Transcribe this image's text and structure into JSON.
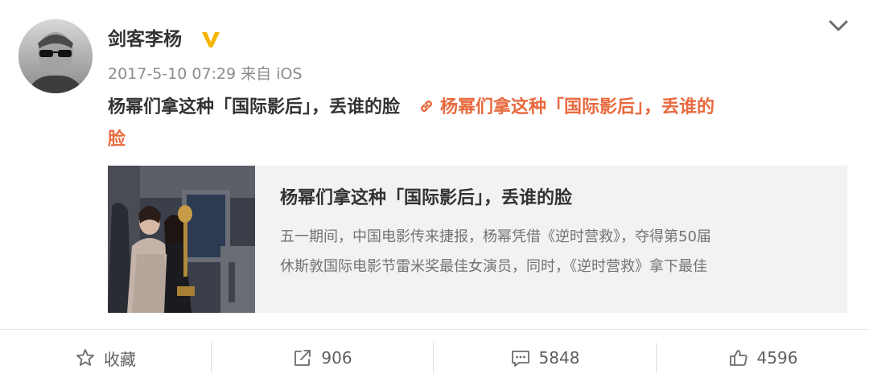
{
  "post": {
    "username": "剑客李杨",
    "timestamp": "2017-5-10 07:29",
    "source": "来自 iOS",
    "text": "杨幂们拿这种「国际影后」，丢谁的脸",
    "link_text": "杨幂们拿这种「国际影后」，丢谁的",
    "link_text_tail": "脸"
  },
  "card": {
    "title": "杨幂们拿这种「国际影后」，丢谁的脸",
    "desc_line1": "五一期间，中国电影传来捷报，杨幂凭借《逆时营救》，夺得第50届",
    "desc_line2": "休斯敦国际电影节雷米奖最佳女演员，同时，《逆时营救》拿下最佳"
  },
  "actions": {
    "favorite": "收藏",
    "repost": "906",
    "comment": "5848",
    "like": "4596"
  },
  "icons": {
    "verified": "verified-v-icon",
    "menu": "chevron-down-icon",
    "link": "link-icon",
    "favorite": "star-icon",
    "repost": "share-icon",
    "comment": "comment-icon",
    "like": "thumbs-up-icon"
  },
  "colors": {
    "link": "#e86a3f",
    "verified": "#f5b400",
    "card_bg": "#f2f2f2"
  }
}
